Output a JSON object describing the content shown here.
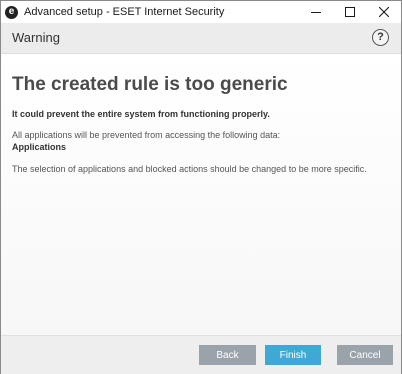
{
  "window": {
    "title": "Advanced setup - ESET Internet Security",
    "logo_letter": "e"
  },
  "header": {
    "title": "Warning",
    "help_symbol": "?"
  },
  "content": {
    "heading": "The created rule is too generic",
    "subheading": "It could prevent the entire system from functioning properly.",
    "info_text": "All applications will be prevented from accessing the following data:",
    "info_value": "Applications",
    "advice": "The selection of applications and blocked actions should be changed to be more specific."
  },
  "footer": {
    "back_label": "Back",
    "finish_label": "Finish",
    "cancel_label": "Cancel"
  },
  "colors": {
    "primary_button": "#3fa9d4",
    "secondary_button": "#9aa3aa",
    "heading_text": "#4b4b4b"
  },
  "icons": [
    "eset-logo-icon",
    "minimize-icon",
    "maximize-icon",
    "close-icon",
    "help-icon"
  ]
}
